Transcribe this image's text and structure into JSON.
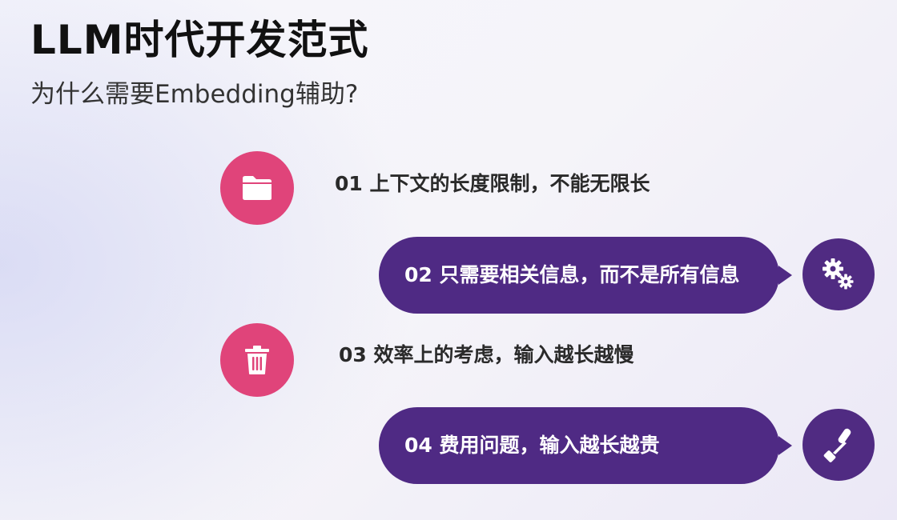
{
  "slide": {
    "title": "LLM时代开发范式",
    "subtitle": "为什么需要Embedding辅助?"
  },
  "items": [
    {
      "text": "01 上下文的长度限制，不能无限长",
      "icon": "folder-icon",
      "style": "pink-circle"
    },
    {
      "text": "02 只需要相关信息，而不是所有信息",
      "icon": "gears-icon",
      "style": "purple-pill"
    },
    {
      "text": "03 效率上的考虑，输入越长越慢",
      "icon": "trash-icon",
      "style": "pink-circle"
    },
    {
      "text": "04 费用问题，输入越长越贵",
      "icon": "paint-roller-icon",
      "style": "purple-pill"
    }
  ],
  "colors": {
    "pink": "#e0447a",
    "purple": "#4f2a84",
    "title": "#111111"
  }
}
